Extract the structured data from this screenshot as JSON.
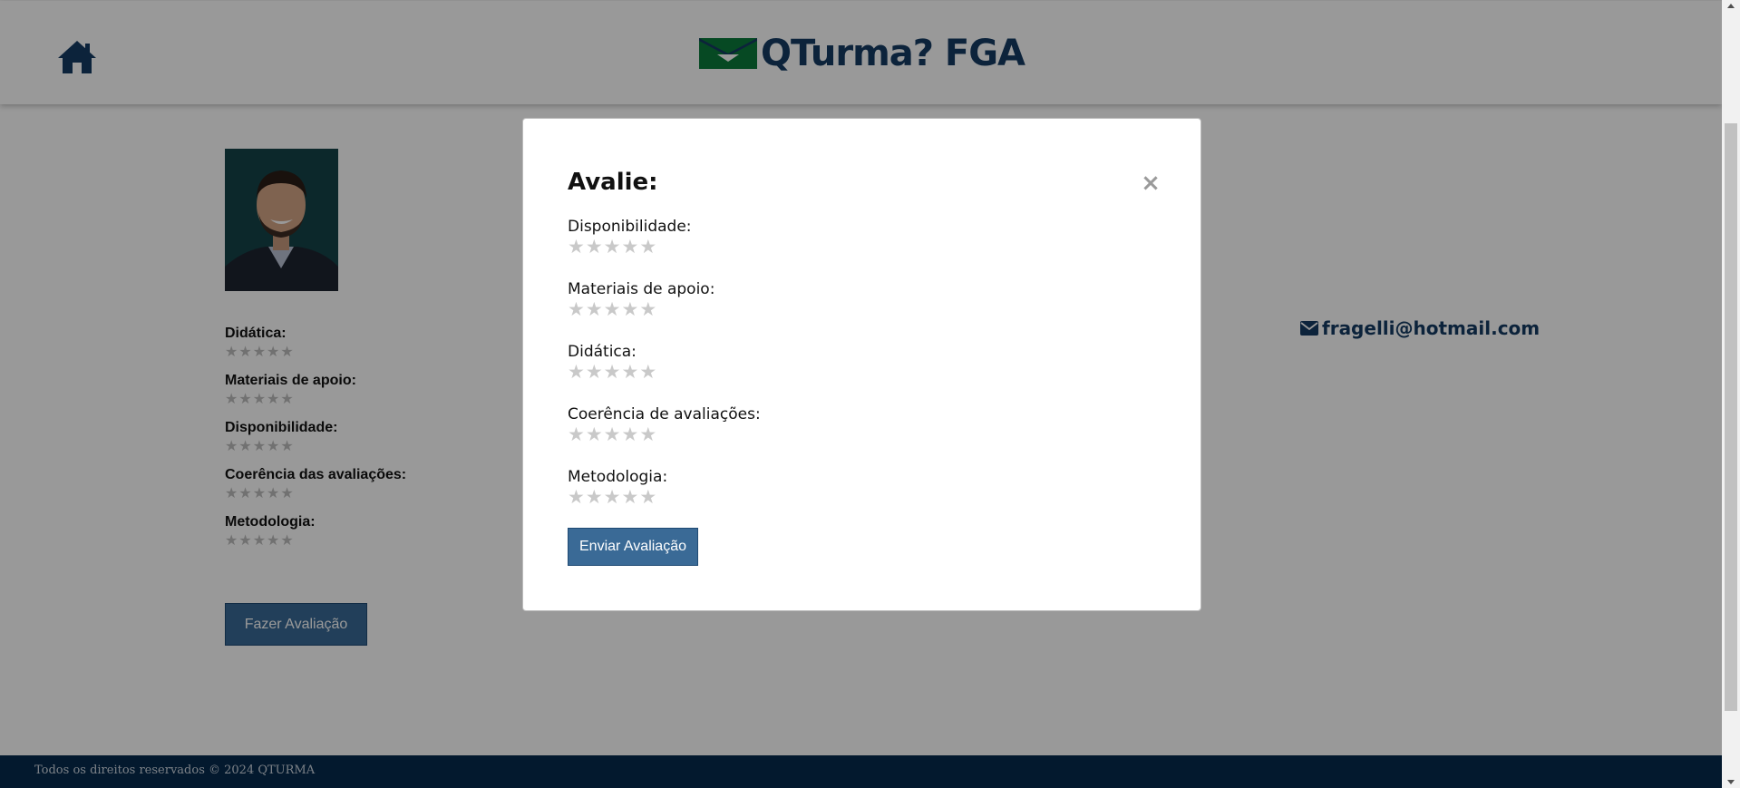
{
  "header": {
    "logo_text": "QTurma? FGA"
  },
  "profile": {
    "ratings": [
      {
        "label": "Didática:"
      },
      {
        "label": "Materiais de apoio:"
      },
      {
        "label": "Disponibilidade:"
      },
      {
        "label": "Coerência das avaliações:"
      },
      {
        "label": "Metodologia:"
      }
    ],
    "do_review_label": "Fazer Avaliação",
    "email": "fragelli@hotmail.com"
  },
  "modal": {
    "title": "Avalie:",
    "close_label": "×",
    "fields": [
      {
        "label": "Disponibilidade:"
      },
      {
        "label": "Materiais de apoio:"
      },
      {
        "label": "Didática:"
      },
      {
        "label": "Coerência de avaliações:"
      },
      {
        "label": "Metodologia:"
      }
    ],
    "submit_label": "Enviar Avaliação"
  },
  "footer": {
    "text": "Todos os direitos reservados © 2024 QTURMA"
  },
  "colors": {
    "brand_navy": "#153b63",
    "button_blue": "#3a6a96",
    "footer_bg": "#052a4d",
    "star_empty": "#c9c9c9"
  }
}
